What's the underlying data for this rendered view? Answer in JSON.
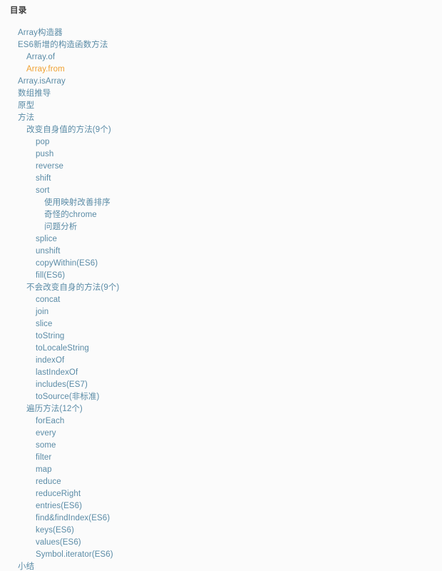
{
  "panel": {
    "title": "目录",
    "text_color": "#5a8ba6",
    "active_color": "#f0a030",
    "title_color": "#3a3a3a",
    "background": "#fbfbfb",
    "page_background": "#f4f4f4"
  },
  "toc": {
    "items": [
      {
        "label": "Array构造器",
        "level": 1,
        "active": false
      },
      {
        "label": "ES6新增的构造函数方法",
        "level": 1,
        "active": false
      },
      {
        "label": "Array.of",
        "level": 2,
        "active": false
      },
      {
        "label": "Array.from",
        "level": 2,
        "active": true
      },
      {
        "label": "Array.isArray",
        "level": 1,
        "active": false
      },
      {
        "label": "数组推导",
        "level": 1,
        "active": false
      },
      {
        "label": "原型",
        "level": 1,
        "active": false
      },
      {
        "label": "方法",
        "level": 1,
        "active": false
      },
      {
        "label": "改变自身值的方法(9个)",
        "level": 2,
        "active": false
      },
      {
        "label": "pop",
        "level": 3,
        "active": false
      },
      {
        "label": "push",
        "level": 3,
        "active": false
      },
      {
        "label": "reverse",
        "level": 3,
        "active": false
      },
      {
        "label": "shift",
        "level": 3,
        "active": false
      },
      {
        "label": "sort",
        "level": 3,
        "active": false
      },
      {
        "label": "使用映射改善排序",
        "level": 4,
        "active": false
      },
      {
        "label": "奇怪的chrome",
        "level": 4,
        "active": false
      },
      {
        "label": "问题分析",
        "level": 4,
        "active": false
      },
      {
        "label": "splice",
        "level": 3,
        "active": false
      },
      {
        "label": "unshift",
        "level": 3,
        "active": false
      },
      {
        "label": "copyWithin(ES6)",
        "level": 3,
        "active": false
      },
      {
        "label": "fill(ES6)",
        "level": 3,
        "active": false
      },
      {
        "label": "不会改变自身的方法(9个)",
        "level": 2,
        "active": false
      },
      {
        "label": "concat",
        "level": 3,
        "active": false
      },
      {
        "label": "join",
        "level": 3,
        "active": false
      },
      {
        "label": "slice",
        "level": 3,
        "active": false
      },
      {
        "label": "toString",
        "level": 3,
        "active": false
      },
      {
        "label": "toLocaleString",
        "level": 3,
        "active": false
      },
      {
        "label": "indexOf",
        "level": 3,
        "active": false
      },
      {
        "label": "lastIndexOf",
        "level": 3,
        "active": false
      },
      {
        "label": "includes(ES7)",
        "level": 3,
        "active": false
      },
      {
        "label": "toSource(非标准)",
        "level": 3,
        "active": false
      },
      {
        "label": "遍历方法(12个)",
        "level": 2,
        "active": false
      },
      {
        "label": "forEach",
        "level": 3,
        "active": false
      },
      {
        "label": "every",
        "level": 3,
        "active": false
      },
      {
        "label": "some",
        "level": 3,
        "active": false
      },
      {
        "label": "filter",
        "level": 3,
        "active": false
      },
      {
        "label": "map",
        "level": 3,
        "active": false
      },
      {
        "label": "reduce",
        "level": 3,
        "active": false
      },
      {
        "label": "reduceRight",
        "level": 3,
        "active": false
      },
      {
        "label": "entries(ES6)",
        "level": 3,
        "active": false
      },
      {
        "label": "find&findIndex(ES6)",
        "level": 3,
        "active": false
      },
      {
        "label": "keys(ES6)",
        "level": 3,
        "active": false
      },
      {
        "label": "values(ES6)",
        "level": 3,
        "active": false
      },
      {
        "label": "Symbol.iterator(ES6)",
        "level": 3,
        "active": false
      },
      {
        "label": "小结",
        "level": 1,
        "active": false
      }
    ]
  }
}
